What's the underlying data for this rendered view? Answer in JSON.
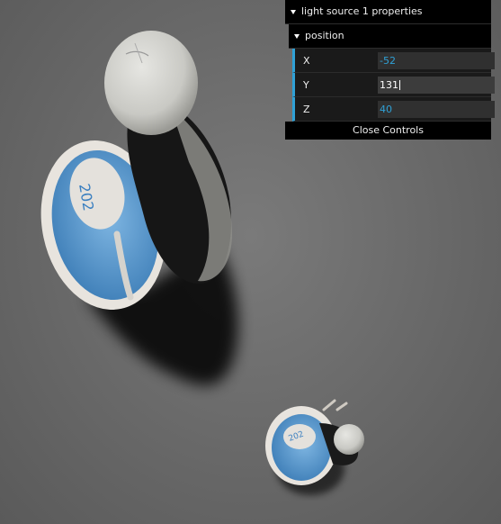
{
  "gui": {
    "folder_title": "light source 1 properties",
    "subfolder_title": "position",
    "fields": [
      {
        "label": "X",
        "value": "-52"
      },
      {
        "label": "Y",
        "value": "131"
      },
      {
        "label": "Z",
        "value": "40"
      }
    ],
    "close_label": "Close Controls"
  },
  "scene": {
    "large_figure_skirt_text": "202",
    "small_figure_skirt_text": "202",
    "accent_color": "#2fa1d6",
    "skirt_color": "#5b9fd6"
  }
}
